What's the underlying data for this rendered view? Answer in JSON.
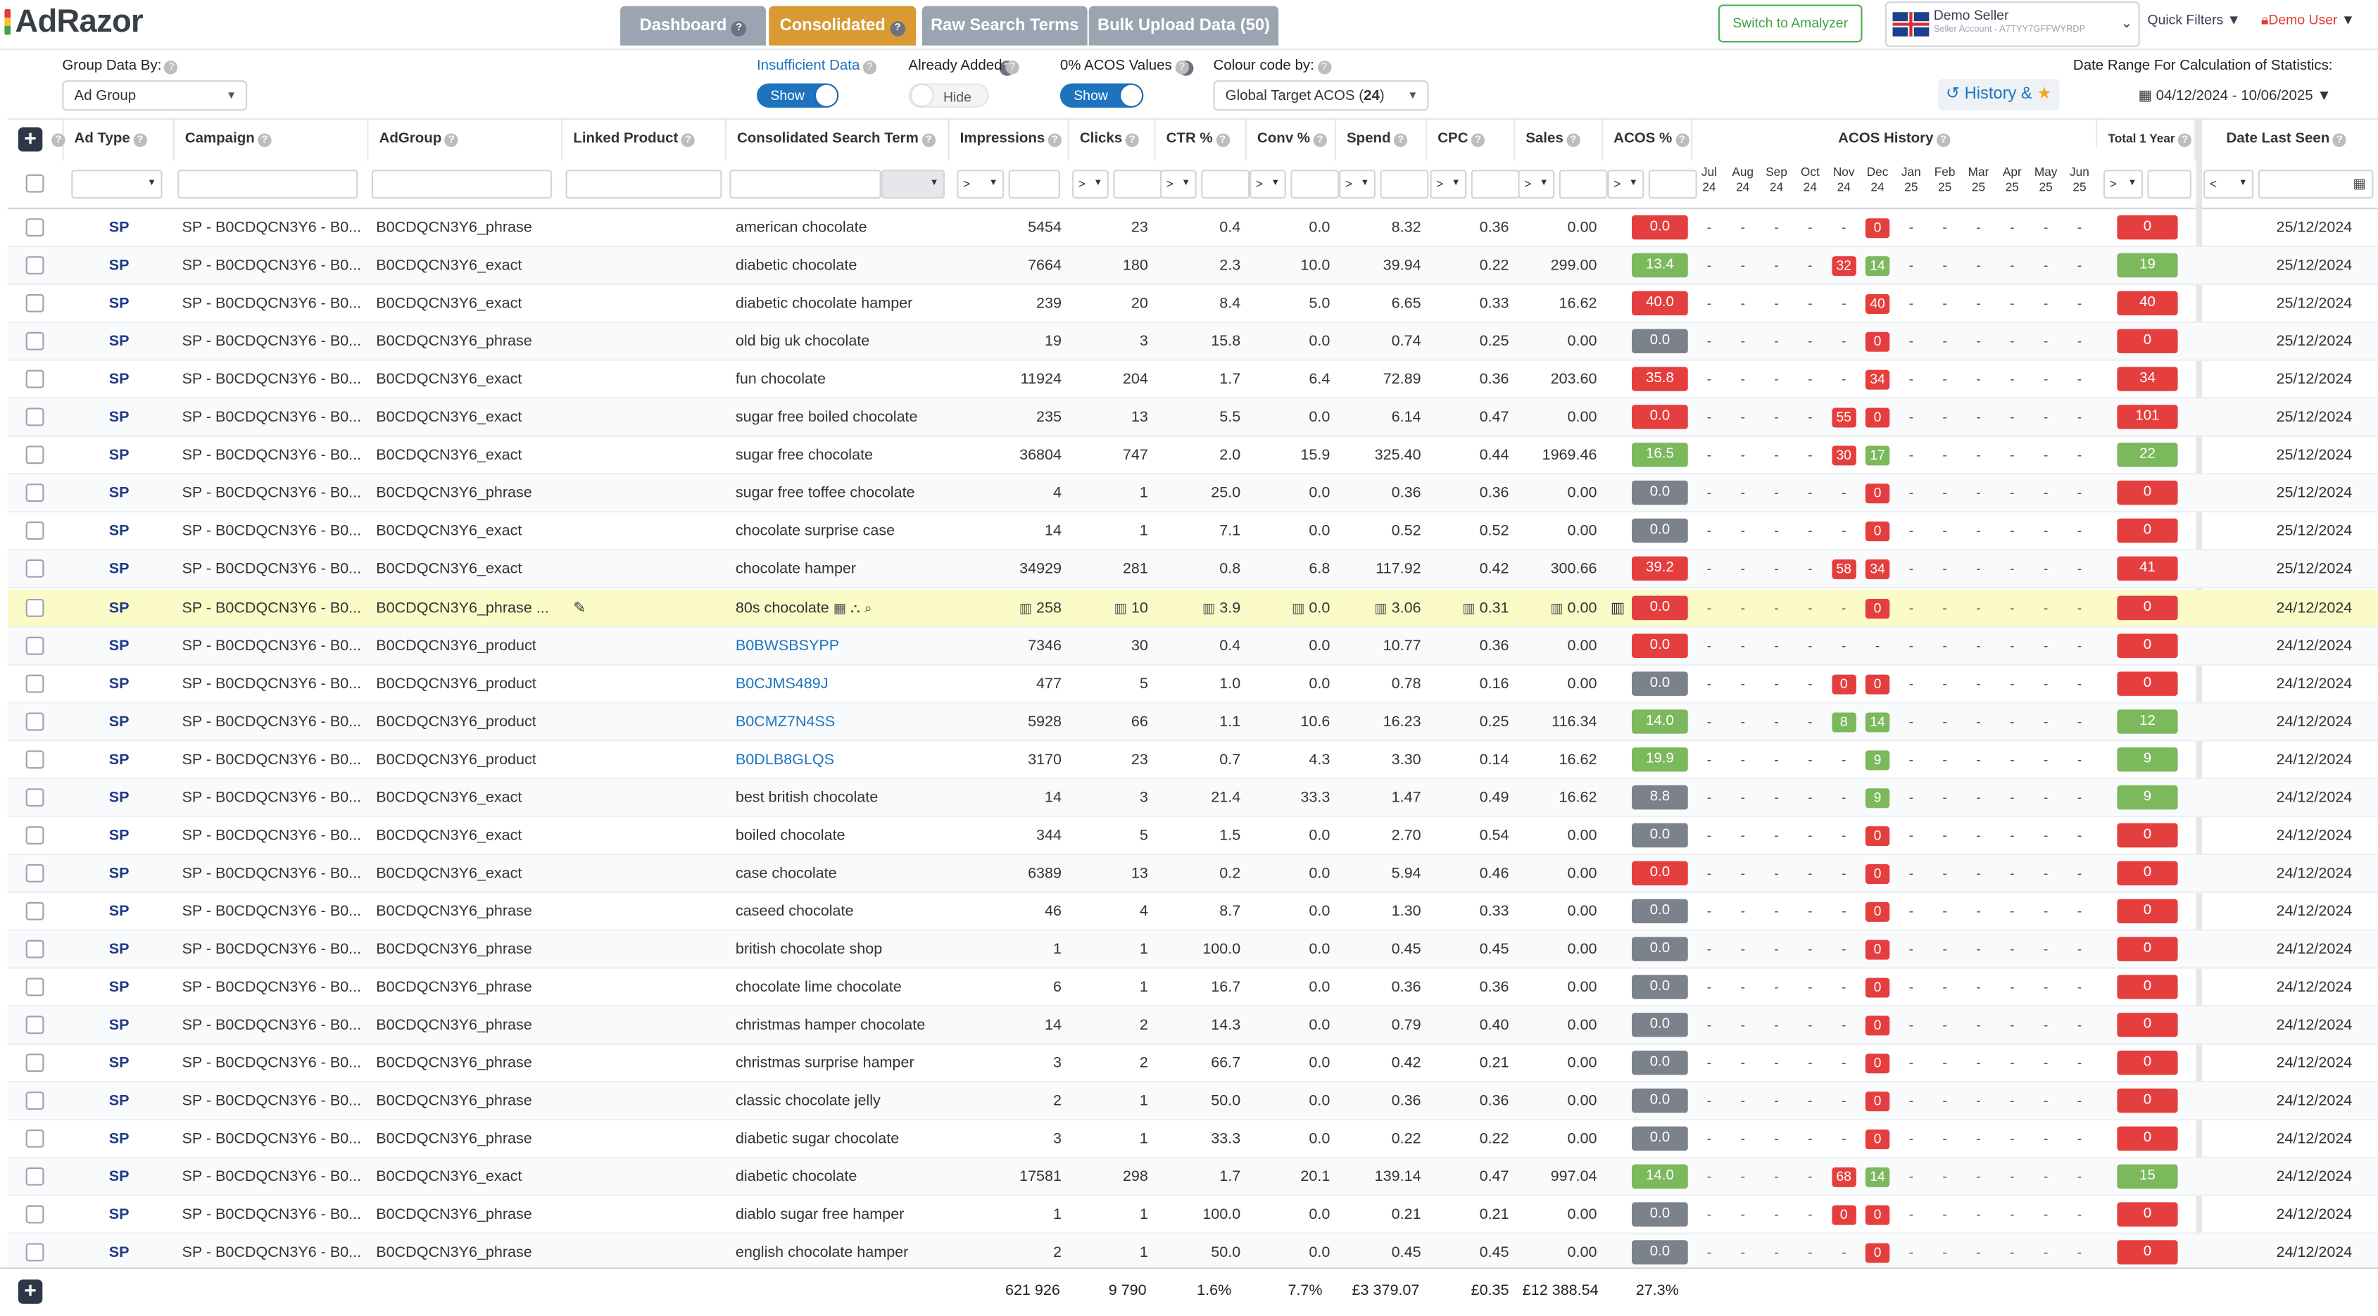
{
  "app": {
    "logo": "AdRazor"
  },
  "nav": {
    "tabs": [
      {
        "label": "Dashboard",
        "active": false
      },
      {
        "label": "Consolidated",
        "active": true
      },
      {
        "label": "Raw Search Terms",
        "active": false
      },
      {
        "label": "Bulk Upload Data (50)",
        "active": false
      }
    ]
  },
  "header": {
    "switch_label": "Switch to Amalyzer",
    "seller_name": "Demo Seller",
    "seller_account": "Seller Account - A7TYY7GFFWYRDP",
    "quick_filters": "Quick Filters",
    "user": "Demo User"
  },
  "controls": {
    "group_by_label": "Group Data By:",
    "group_by_value": "Ad Group",
    "insufficient_label": "Insufficient Data",
    "insufficient_toggle": "Show",
    "already_added_label": "Already Added",
    "already_added_toggle": "Hide",
    "zero_acos_label": "0% ACOS Values",
    "zero_acos_toggle": "Show",
    "colour_label": "Colour code by:",
    "colour_value": "Global Target ACOS",
    "colour_target": "24",
    "history_label": "History &",
    "date_range_label": "Date Range For Calculation of Statistics:",
    "date_range_value": "04/12/2024 - 10/06/2025"
  },
  "columns": {
    "ad_type": "Ad Type",
    "campaign": "Campaign",
    "adgroup": "AdGroup",
    "linked": "Linked Product",
    "term": "Consolidated Search Term",
    "impressions": "Impressions",
    "clicks": "Clicks",
    "ctr": "CTR %",
    "conv": "Conv %",
    "spend": "Spend",
    "cpc": "CPC",
    "sales": "Sales",
    "acos": "ACOS %",
    "acos_history": "ACOS History",
    "total": "Total 1 Year",
    "last_seen": "Date Last Seen"
  },
  "months": [
    [
      "Jul",
      "24"
    ],
    [
      "Aug",
      "24"
    ],
    [
      "Sep",
      "24"
    ],
    [
      "Oct",
      "24"
    ],
    [
      "Nov",
      "24"
    ],
    [
      "Dec",
      "24"
    ],
    [
      "Jan",
      "25"
    ],
    [
      "Feb",
      "25"
    ],
    [
      "Mar",
      "25"
    ],
    [
      "Apr",
      "25"
    ],
    [
      "May",
      "25"
    ],
    [
      "Jun",
      "25"
    ]
  ],
  "filter_ops": {
    "gt": ">",
    "lt": "<"
  },
  "rows": [
    {
      "type": "SP",
      "campaign": "SP - B0CDQCN3Y6 - B0...",
      "adgroup": "B0CDQCN3Y6_phrase",
      "term": "american chocolate",
      "link": false,
      "imp": "5454",
      "clicks": "23",
      "ctr": "0.4",
      "conv": "0.0",
      "spend": "8.32",
      "cpc": "0.36",
      "sales": "0.00",
      "acos": "0.0",
      "acos_c": "red",
      "nov": "",
      "nov_c": "",
      "dec": "0",
      "dec_c": "red",
      "total": "0",
      "total_c": "red",
      "date": "25/12/2024"
    },
    {
      "type": "SP",
      "campaign": "SP - B0CDQCN3Y6 - B0...",
      "adgroup": "B0CDQCN3Y6_exact",
      "term": "diabetic chocolate",
      "link": false,
      "imp": "7664",
      "clicks": "180",
      "ctr": "2.3",
      "conv": "10.0",
      "spend": "39.94",
      "cpc": "0.22",
      "sales": "299.00",
      "acos": "13.4",
      "acos_c": "green",
      "nov": "32",
      "nov_c": "red",
      "dec": "14",
      "dec_c": "green",
      "total": "19",
      "total_c": "green",
      "date": "25/12/2024"
    },
    {
      "type": "SP",
      "campaign": "SP - B0CDQCN3Y6 - B0...",
      "adgroup": "B0CDQCN3Y6_exact",
      "term": "diabetic chocolate hamper",
      "link": false,
      "imp": "239",
      "clicks": "20",
      "ctr": "8.4",
      "conv": "5.0",
      "spend": "6.65",
      "cpc": "0.33",
      "sales": "16.62",
      "acos": "40.0",
      "acos_c": "red",
      "nov": "",
      "nov_c": "",
      "dec": "40",
      "dec_c": "red",
      "total": "40",
      "total_c": "red",
      "date": "25/12/2024"
    },
    {
      "type": "SP",
      "campaign": "SP - B0CDQCN3Y6 - B0...",
      "adgroup": "B0CDQCN3Y6_phrase",
      "term": "old big uk chocolate",
      "link": false,
      "imp": "19",
      "clicks": "3",
      "ctr": "15.8",
      "conv": "0.0",
      "spend": "0.74",
      "cpc": "0.25",
      "sales": "0.00",
      "acos": "0.0",
      "acos_c": "gray",
      "nov": "",
      "nov_c": "",
      "dec": "0",
      "dec_c": "red",
      "total": "0",
      "total_c": "red",
      "date": "25/12/2024"
    },
    {
      "type": "SP",
      "campaign": "SP - B0CDQCN3Y6 - B0...",
      "adgroup": "B0CDQCN3Y6_exact",
      "term": "fun chocolate",
      "link": false,
      "imp": "11924",
      "clicks": "204",
      "ctr": "1.7",
      "conv": "6.4",
      "spend": "72.89",
      "cpc": "0.36",
      "sales": "203.60",
      "acos": "35.8",
      "acos_c": "red",
      "nov": "",
      "nov_c": "",
      "dec": "34",
      "dec_c": "red",
      "total": "34",
      "total_c": "red",
      "date": "25/12/2024"
    },
    {
      "type": "SP",
      "campaign": "SP - B0CDQCN3Y6 - B0...",
      "adgroup": "B0CDQCN3Y6_exact",
      "term": "sugar free boiled chocolate",
      "link": false,
      "imp": "235",
      "clicks": "13",
      "ctr": "5.5",
      "conv": "0.0",
      "spend": "6.14",
      "cpc": "0.47",
      "sales": "0.00",
      "acos": "0.0",
      "acos_c": "red",
      "nov": "55",
      "nov_c": "red",
      "dec": "0",
      "dec_c": "red",
      "total": "101",
      "total_c": "red",
      "date": "25/12/2024"
    },
    {
      "type": "SP",
      "campaign": "SP - B0CDQCN3Y6 - B0...",
      "adgroup": "B0CDQCN3Y6_exact",
      "term": "sugar free chocolate",
      "link": false,
      "imp": "36804",
      "clicks": "747",
      "ctr": "2.0",
      "conv": "15.9",
      "spend": "325.40",
      "cpc": "0.44",
      "sales": "1969.46",
      "acos": "16.5",
      "acos_c": "green",
      "nov": "30",
      "nov_c": "red",
      "dec": "17",
      "dec_c": "green",
      "total": "22",
      "total_c": "green",
      "date": "25/12/2024"
    },
    {
      "type": "SP",
      "campaign": "SP - B0CDQCN3Y6 - B0...",
      "adgroup": "B0CDQCN3Y6_phrase",
      "term": "sugar free toffee chocolate",
      "link": false,
      "imp": "4",
      "clicks": "1",
      "ctr": "25.0",
      "conv": "0.0",
      "spend": "0.36",
      "cpc": "0.36",
      "sales": "0.00",
      "acos": "0.0",
      "acos_c": "gray",
      "nov": "",
      "nov_c": "",
      "dec": "0",
      "dec_c": "red",
      "total": "0",
      "total_c": "red",
      "date": "25/12/2024"
    },
    {
      "type": "SP",
      "campaign": "SP - B0CDQCN3Y6 - B0...",
      "adgroup": "B0CDQCN3Y6_exact",
      "term": "chocolate surprise case",
      "link": false,
      "imp": "14",
      "clicks": "1",
      "ctr": "7.1",
      "conv": "0.0",
      "spend": "0.52",
      "cpc": "0.52",
      "sales": "0.00",
      "acos": "0.0",
      "acos_c": "gray",
      "nov": "",
      "nov_c": "",
      "dec": "0",
      "dec_c": "red",
      "total": "0",
      "total_c": "red",
      "date": "25/12/2024"
    },
    {
      "type": "SP",
      "campaign": "SP - B0CDQCN3Y6 - B0...",
      "adgroup": "B0CDQCN3Y6_exact",
      "term": "chocolate hamper",
      "link": false,
      "imp": "34929",
      "clicks": "281",
      "ctr": "0.8",
      "conv": "6.8",
      "spend": "117.92",
      "cpc": "0.42",
      "sales": "300.66",
      "acos": "39.2",
      "acos_c": "red",
      "nov": "58",
      "nov_c": "red",
      "dec": "34",
      "dec_c": "red",
      "total": "41",
      "total_c": "red",
      "date": "25/12/2024"
    },
    {
      "type": "SP",
      "campaign": "SP - B0CDQCN3Y6 - B0...",
      "adgroup": "B0CDQCN3Y6_phrase ...",
      "term": "80s chocolate",
      "link": false,
      "highlight": true,
      "imp": "258",
      "clicks": "10",
      "ctr": "3.9",
      "conv": "0.0",
      "spend": "3.06",
      "cpc": "0.31",
      "sales": "0.00",
      "acos": "0.0",
      "acos_c": "red",
      "nov": "",
      "nov_c": "",
      "dec": "0",
      "dec_c": "red",
      "total": "0",
      "total_c": "red",
      "date": "24/12/2024"
    },
    {
      "type": "SP",
      "campaign": "SP - B0CDQCN3Y6 - B0...",
      "adgroup": "B0CDQCN3Y6_product",
      "term": "B0BWSBSYPP",
      "link": true,
      "imp": "7346",
      "clicks": "30",
      "ctr": "0.4",
      "conv": "0.0",
      "spend": "10.77",
      "cpc": "0.36",
      "sales": "0.00",
      "acos": "0.0",
      "acos_c": "red",
      "nov": "",
      "nov_c": "",
      "dec": "",
      "dec_c": "",
      "total": "0",
      "total_c": "red",
      "date": "24/12/2024"
    },
    {
      "type": "SP",
      "campaign": "SP - B0CDQCN3Y6 - B0...",
      "adgroup": "B0CDQCN3Y6_product",
      "term": "B0CJMS489J",
      "link": true,
      "imp": "477",
      "clicks": "5",
      "ctr": "1.0",
      "conv": "0.0",
      "spend": "0.78",
      "cpc": "0.16",
      "sales": "0.00",
      "acos": "0.0",
      "acos_c": "gray",
      "nov": "0",
      "nov_c": "red",
      "dec": "0",
      "dec_c": "red",
      "total": "0",
      "total_c": "red",
      "date": "24/12/2024"
    },
    {
      "type": "SP",
      "campaign": "SP - B0CDQCN3Y6 - B0...",
      "adgroup": "B0CDQCN3Y6_product",
      "term": "B0CMZ7N4SS",
      "link": true,
      "imp": "5928",
      "clicks": "66",
      "ctr": "1.1",
      "conv": "10.6",
      "spend": "16.23",
      "cpc": "0.25",
      "sales": "116.34",
      "acos": "14.0",
      "acos_c": "green",
      "nov": "8",
      "nov_c": "green",
      "dec": "14",
      "dec_c": "green",
      "total": "12",
      "total_c": "green",
      "date": "24/12/2024"
    },
    {
      "type": "SP",
      "campaign": "SP - B0CDQCN3Y6 - B0...",
      "adgroup": "B0CDQCN3Y6_product",
      "term": "B0DLB8GLQS",
      "link": true,
      "imp": "3170",
      "clicks": "23",
      "ctr": "0.7",
      "conv": "4.3",
      "spend": "3.30",
      "cpc": "0.14",
      "sales": "16.62",
      "acos": "19.9",
      "acos_c": "green",
      "nov": "",
      "nov_c": "",
      "dec": "9",
      "dec_c": "green",
      "total": "9",
      "total_c": "green",
      "date": "24/12/2024"
    },
    {
      "type": "SP",
      "campaign": "SP - B0CDQCN3Y6 - B0...",
      "adgroup": "B0CDQCN3Y6_exact",
      "term": "best british chocolate",
      "link": false,
      "imp": "14",
      "clicks": "3",
      "ctr": "21.4",
      "conv": "33.3",
      "spend": "1.47",
      "cpc": "0.49",
      "sales": "16.62",
      "acos": "8.8",
      "acos_c": "gray",
      "nov": "",
      "nov_c": "",
      "dec": "9",
      "dec_c": "green",
      "total": "9",
      "total_c": "green",
      "date": "24/12/2024"
    },
    {
      "type": "SP",
      "campaign": "SP - B0CDQCN3Y6 - B0...",
      "adgroup": "B0CDQCN3Y6_exact",
      "term": "boiled chocolate",
      "link": false,
      "imp": "344",
      "clicks": "5",
      "ctr": "1.5",
      "conv": "0.0",
      "spend": "2.70",
      "cpc": "0.54",
      "sales": "0.00",
      "acos": "0.0",
      "acos_c": "gray",
      "nov": "",
      "nov_c": "",
      "dec": "0",
      "dec_c": "red",
      "total": "0",
      "total_c": "red",
      "date": "24/12/2024"
    },
    {
      "type": "SP",
      "campaign": "SP - B0CDQCN3Y6 - B0...",
      "adgroup": "B0CDQCN3Y6_exact",
      "term": "case chocolate",
      "link": false,
      "imp": "6389",
      "clicks": "13",
      "ctr": "0.2",
      "conv": "0.0",
      "spend": "5.94",
      "cpc": "0.46",
      "sales": "0.00",
      "acos": "0.0",
      "acos_c": "red",
      "nov": "",
      "nov_c": "",
      "dec": "0",
      "dec_c": "red",
      "total": "0",
      "total_c": "red",
      "date": "24/12/2024"
    },
    {
      "type": "SP",
      "campaign": "SP - B0CDQCN3Y6 - B0...",
      "adgroup": "B0CDQCN3Y6_phrase",
      "term": "caseed chocolate",
      "link": false,
      "imp": "46",
      "clicks": "4",
      "ctr": "8.7",
      "conv": "0.0",
      "spend": "1.30",
      "cpc": "0.33",
      "sales": "0.00",
      "acos": "0.0",
      "acos_c": "gray",
      "nov": "",
      "nov_c": "",
      "dec": "0",
      "dec_c": "red",
      "total": "0",
      "total_c": "red",
      "date": "24/12/2024"
    },
    {
      "type": "SP",
      "campaign": "SP - B0CDQCN3Y6 - B0...",
      "adgroup": "B0CDQCN3Y6_phrase",
      "term": "british chocolate shop",
      "link": false,
      "imp": "1",
      "clicks": "1",
      "ctr": "100.0",
      "conv": "0.0",
      "spend": "0.45",
      "cpc": "0.45",
      "sales": "0.00",
      "acos": "0.0",
      "acos_c": "gray",
      "nov": "",
      "nov_c": "",
      "dec": "0",
      "dec_c": "red",
      "total": "0",
      "total_c": "red",
      "date": "24/12/2024"
    },
    {
      "type": "SP",
      "campaign": "SP - B0CDQCN3Y6 - B0...",
      "adgroup": "B0CDQCN3Y6_phrase",
      "term": "chocolate lime chocolate",
      "link": false,
      "imp": "6",
      "clicks": "1",
      "ctr": "16.7",
      "conv": "0.0",
      "spend": "0.36",
      "cpc": "0.36",
      "sales": "0.00",
      "acos": "0.0",
      "acos_c": "gray",
      "nov": "",
      "nov_c": "",
      "dec": "0",
      "dec_c": "red",
      "total": "0",
      "total_c": "red",
      "date": "24/12/2024"
    },
    {
      "type": "SP",
      "campaign": "SP - B0CDQCN3Y6 - B0...",
      "adgroup": "B0CDQCN3Y6_phrase",
      "term": "christmas hamper chocolate",
      "link": false,
      "imp": "14",
      "clicks": "2",
      "ctr": "14.3",
      "conv": "0.0",
      "spend": "0.79",
      "cpc": "0.40",
      "sales": "0.00",
      "acos": "0.0",
      "acos_c": "gray",
      "nov": "",
      "nov_c": "",
      "dec": "0",
      "dec_c": "red",
      "total": "0",
      "total_c": "red",
      "date": "24/12/2024"
    },
    {
      "type": "SP",
      "campaign": "SP - B0CDQCN3Y6 - B0...",
      "adgroup": "B0CDQCN3Y6_phrase",
      "term": "christmas surprise hamper",
      "link": false,
      "imp": "3",
      "clicks": "2",
      "ctr": "66.7",
      "conv": "0.0",
      "spend": "0.42",
      "cpc": "0.21",
      "sales": "0.00",
      "acos": "0.0",
      "acos_c": "gray",
      "nov": "",
      "nov_c": "",
      "dec": "0",
      "dec_c": "red",
      "total": "0",
      "total_c": "red",
      "date": "24/12/2024"
    },
    {
      "type": "SP",
      "campaign": "SP - B0CDQCN3Y6 - B0...",
      "adgroup": "B0CDQCN3Y6_phrase",
      "term": "classic chocolate jelly",
      "link": false,
      "imp": "2",
      "clicks": "1",
      "ctr": "50.0",
      "conv": "0.0",
      "spend": "0.36",
      "cpc": "0.36",
      "sales": "0.00",
      "acos": "0.0",
      "acos_c": "gray",
      "nov": "",
      "nov_c": "",
      "dec": "0",
      "dec_c": "red",
      "total": "0",
      "total_c": "red",
      "date": "24/12/2024"
    },
    {
      "type": "SP",
      "campaign": "SP - B0CDQCN3Y6 - B0...",
      "adgroup": "B0CDQCN3Y6_phrase",
      "term": "diabetic sugar chocolate",
      "link": false,
      "imp": "3",
      "clicks": "1",
      "ctr": "33.3",
      "conv": "0.0",
      "spend": "0.22",
      "cpc": "0.22",
      "sales": "0.00",
      "acos": "0.0",
      "acos_c": "gray",
      "nov": "",
      "nov_c": "",
      "dec": "0",
      "dec_c": "red",
      "total": "0",
      "total_c": "red",
      "date": "24/12/2024"
    },
    {
      "type": "SP",
      "campaign": "SP - B0CDQCN3Y6 - B0...",
      "adgroup": "B0CDQCN3Y6_exact",
      "term": "diabetic chocolate",
      "link": false,
      "imp": "17581",
      "clicks": "298",
      "ctr": "1.7",
      "conv": "20.1",
      "spend": "139.14",
      "cpc": "0.47",
      "sales": "997.04",
      "acos": "14.0",
      "acos_c": "green",
      "nov": "68",
      "nov_c": "red",
      "dec": "14",
      "dec_c": "green",
      "total": "15",
      "total_c": "green",
      "date": "24/12/2024"
    },
    {
      "type": "SP",
      "campaign": "SP - B0CDQCN3Y6 - B0...",
      "adgroup": "B0CDQCN3Y6_phrase",
      "term": "diablo sugar free hamper",
      "link": false,
      "imp": "1",
      "clicks": "1",
      "ctr": "100.0",
      "conv": "0.0",
      "spend": "0.21",
      "cpc": "0.21",
      "sales": "0.00",
      "acos": "0.0",
      "acos_c": "gray",
      "nov": "0",
      "nov_c": "red",
      "dec": "0",
      "dec_c": "red",
      "total": "0",
      "total_c": "red",
      "date": "24/12/2024"
    },
    {
      "type": "SP",
      "campaign": "SP - B0CDQCN3Y6 - B0...",
      "adgroup": "B0CDQCN3Y6_phrase",
      "term": "english chocolate hamper",
      "link": false,
      "imp": "2",
      "clicks": "1",
      "ctr": "50.0",
      "conv": "0.0",
      "spend": "0.45",
      "cpc": "0.45",
      "sales": "0.00",
      "acos": "0.0",
      "acos_c": "gray",
      "nov": "",
      "nov_c": "",
      "dec": "0",
      "dec_c": "red",
      "total": "0",
      "total_c": "red",
      "date": "24/12/2024"
    }
  ],
  "totals": {
    "impressions": "621 926",
    "clicks": "9 790",
    "ctr": "1.6%",
    "conv": "7.7%",
    "spend": "£3 379.07",
    "cpc": "£0.35",
    "sales": "£12 388.54",
    "acos": "27.3%"
  },
  "colors": {
    "red": "#e53e3e",
    "green": "#7cb85c",
    "gray": "#7b828b",
    "accent": "#1e73be",
    "active_tab": "#d99a33",
    "highlight": "#fbfbc8"
  }
}
